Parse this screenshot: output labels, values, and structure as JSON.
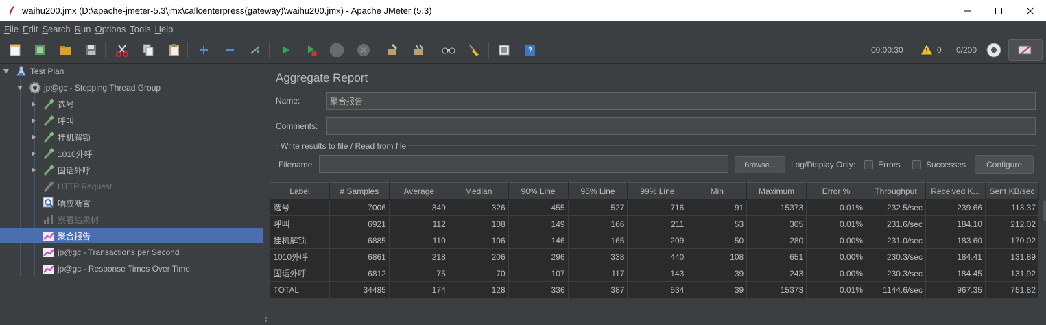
{
  "window": {
    "title": "waihu200.jmx (D:\\apache-jmeter-5.3\\jmx\\callcenterpress(gateway)\\waihu200.jmx) - Apache JMeter (5.3)",
    "minimize": "—",
    "maximize": "☐",
    "close": "✕"
  },
  "menu": {
    "items": [
      {
        "u": "F",
        "rest": "ile"
      },
      {
        "u": "E",
        "rest": "dit"
      },
      {
        "u": "S",
        "rest": "earch"
      },
      {
        "u": "R",
        "rest": "un"
      },
      {
        "u": "O",
        "rest": "ptions"
      },
      {
        "u": "T",
        "rest": "ools"
      },
      {
        "u": "H",
        "rest": "elp"
      }
    ]
  },
  "status": {
    "timer": "00:00:30",
    "warnings": "0",
    "threads": "0/200"
  },
  "tree": {
    "test_plan": "Test Plan",
    "thread_group": "jp@gc - Stepping Thread Group",
    "nodes": [
      "选号",
      "呼叫",
      "挂机解锁",
      "1010外呼",
      "固话外呼"
    ],
    "http_request": "HTTP Request",
    "assertion": "响应断言",
    "view_tree": "察看结果树",
    "aggregate": "聚合报告",
    "tps": "jp@gc - Transactions per Second",
    "rt": "jp@gc - Response Times Over Time"
  },
  "panel": {
    "title": "Aggregate Report",
    "name_label": "Name:",
    "name_value": "聚合报告",
    "comments_label": "Comments:",
    "comments_value": "",
    "write_results": "Write results to file / Read from file",
    "filename_label": "Filename",
    "filename_value": "",
    "browse": "Browse...",
    "log_display": "Log/Display Only:",
    "errors": "Errors",
    "successes": "Successes",
    "configure": "Configure"
  },
  "table": {
    "headers": [
      "Label",
      "# Samples",
      "Average",
      "Median",
      "90% Line",
      "95% Line",
      "99% Line",
      "Min",
      "Maximum",
      "Error %",
      "Throughput",
      "Received K...",
      "Sent KB/sec"
    ],
    "rows": [
      [
        "选号",
        "7006",
        "349",
        "326",
        "455",
        "527",
        "716",
        "91",
        "15373",
        "0.01%",
        "232.5/sec",
        "239.66",
        "113.37"
      ],
      [
        "呼叫",
        "6921",
        "112",
        "108",
        "149",
        "166",
        "211",
        "53",
        "305",
        "0.01%",
        "231.6/sec",
        "184.10",
        "212.02"
      ],
      [
        "挂机解锁",
        "6885",
        "110",
        "106",
        "146",
        "165",
        "209",
        "50",
        "280",
        "0.00%",
        "231.0/sec",
        "183.60",
        "170.02"
      ],
      [
        "1010外呼",
        "6861",
        "218",
        "206",
        "296",
        "338",
        "440",
        "108",
        "651",
        "0.00%",
        "230.3/sec",
        "184.41",
        "131.89"
      ],
      [
        "固话外呼",
        "6812",
        "75",
        "70",
        "107",
        "117",
        "143",
        "39",
        "243",
        "0.00%",
        "230.3/sec",
        "184.45",
        "131.92"
      ],
      [
        "TOTAL",
        "34485",
        "174",
        "128",
        "336",
        "387",
        "534",
        "39",
        "15373",
        "0.01%",
        "1144.6/sec",
        "967.35",
        "751.82"
      ]
    ]
  }
}
